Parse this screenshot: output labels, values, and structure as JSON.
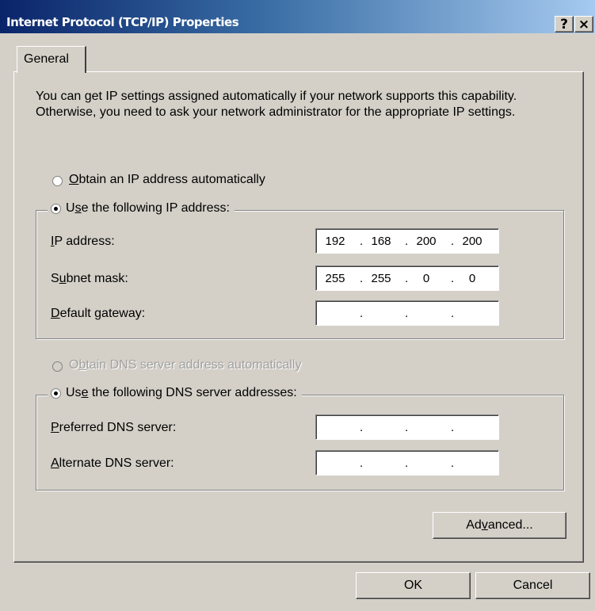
{
  "window": {
    "title": "Internet Protocol (TCP/IP) Properties",
    "help_button": "?",
    "close_button": "×"
  },
  "tabs": [
    {
      "label": "General"
    }
  ],
  "description": "You can get IP settings assigned automatically if your network supports this capability. Otherwise, you need to ask your network administrator for the appropriate IP settings.",
  "ip": {
    "auto_option": {
      "prefix": "",
      "accel": "O",
      "rest": "btain an IP address automatically",
      "selected": false
    },
    "manual_option": {
      "prefix": "U",
      "accel": "s",
      "rest": "e the following IP address:",
      "selected": true
    },
    "fields": [
      {
        "pre": "",
        "accel": "I",
        "rest": "P address:",
        "octets": [
          "192",
          "168",
          "200",
          "200"
        ]
      },
      {
        "pre": "S",
        "accel": "u",
        "rest": "bnet mask:",
        "octets": [
          "255",
          "255",
          "0",
          "0"
        ]
      },
      {
        "pre": "",
        "accel": "D",
        "rest": "efault gateway:",
        "octets": [
          "",
          "",
          "",
          ""
        ]
      }
    ]
  },
  "dns": {
    "auto_option": {
      "prefix": "O",
      "accel": "b",
      "rest": "tain DNS server address automatically",
      "selected": false,
      "disabled": true
    },
    "manual_option": {
      "prefix": "Us",
      "accel": "e",
      "rest": " the following DNS server addresses:",
      "selected": true
    },
    "fields": [
      {
        "pre": "",
        "accel": "P",
        "rest": "referred DNS server:",
        "octets": [
          "",
          "",
          "",
          ""
        ]
      },
      {
        "pre": "",
        "accel": "A",
        "rest": "lternate DNS server:",
        "octets": [
          "",
          "",
          "",
          ""
        ]
      }
    ]
  },
  "buttons": {
    "advanced": {
      "pre": "Ad",
      "accel": "v",
      "rest": "anced..."
    },
    "ok": "OK",
    "cancel": "Cancel"
  }
}
